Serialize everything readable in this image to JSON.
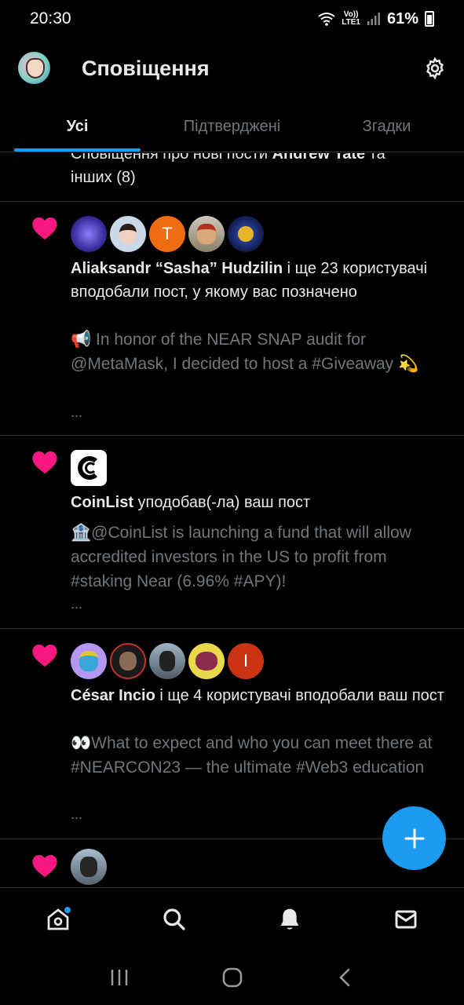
{
  "status_bar": {
    "time": "20:30",
    "network_top": "Vo))",
    "network_bottom": "LTE1",
    "battery": "61%"
  },
  "header": {
    "title": "Сповіщення",
    "settings_icon": "gear-icon"
  },
  "tabs": [
    {
      "label": "Усі",
      "active": true
    },
    {
      "label": "Підтверджені",
      "active": false
    },
    {
      "label": "Згадки",
      "active": false
    }
  ],
  "feed": {
    "truncated": {
      "line1_a": "Сповіщення про нові пости ",
      "line1_bold": "Andrew Tate",
      "line1_b": " та",
      "line2": "інших (8)"
    },
    "items": [
      {
        "icon": "heart-icon",
        "actor": "Aliaksandr “Sasha” Hudzilin",
        "action": " і ще 23 користувачі вподобали пост, у якому вас позначено",
        "snippet": "📢 In honor of the NEAR SNAP audit for @MetaMask, I decided to host a #Giveaway 💫",
        "ellipsis": "...",
        "avatars": [
          "avatar-1",
          "avatar-2",
          "T",
          "avatar-4",
          "avatar-5"
        ]
      },
      {
        "icon": "heart-icon",
        "actor": "CoinList",
        "action": " уподобав(-ла) ваш пост",
        "snippet": "🏦@CoinList  is launching a fund that will allow accredited investors in the US to profit from #staking  Near (6.96% #APY)!",
        "ellipsis": "...",
        "logo_letter": "C"
      },
      {
        "icon": "heart-icon",
        "actor": "César Incio",
        "action": " і ще 4 користувачі вподобали ваш пост",
        "snippet": "👀What to expect and who you can meet there at #NEARCON23 — the ultimate #Web3 education",
        "ellipsis": "...",
        "avatars": [
          "avatar-1",
          "avatar-2",
          "avatar-3",
          "avatar-4",
          "I"
        ]
      },
      {
        "icon": "heart-icon"
      }
    ]
  },
  "fab": {
    "icon": "plus-icon"
  },
  "bottom_nav": [
    "home-icon",
    "search-icon",
    "bell-icon",
    "mail-icon"
  ],
  "colors": {
    "accent": "#1d9bf0",
    "like": "#f91880",
    "background": "#000000",
    "text": "#e7e9ea",
    "muted": "#71767b"
  }
}
